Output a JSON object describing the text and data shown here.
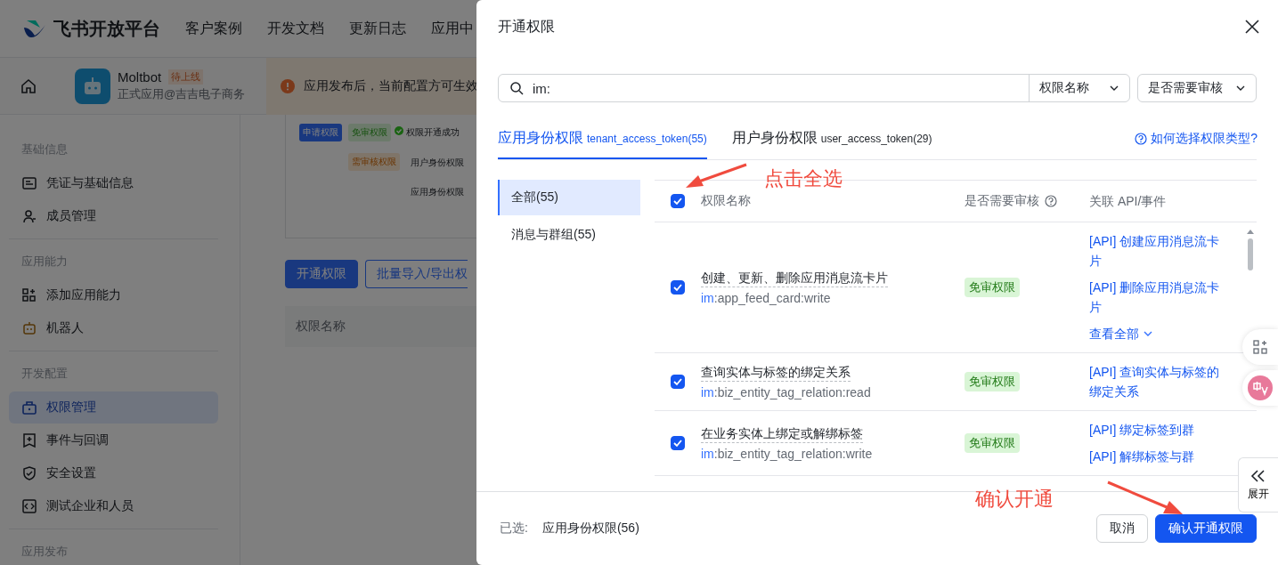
{
  "nav": {
    "brand": "飞书开放平台",
    "links": [
      "客户案例",
      "开发文档",
      "更新日志",
      "应用中"
    ]
  },
  "app": {
    "name": "Moltbot",
    "status": "待上线",
    "subtitle": "正式应用@吉吉电子商务",
    "notice": "应用发布后，当前配置方可生效"
  },
  "sidebar": {
    "sections": [
      {
        "title": "基础信息",
        "items": [
          {
            "label": "凭证与基础信息",
            "selected": false
          },
          {
            "label": "成员管理",
            "selected": false
          }
        ]
      },
      {
        "title": "应用能力",
        "items": [
          {
            "label": "添加应用能力",
            "selected": false
          },
          {
            "label": "机器人",
            "selected": false
          }
        ]
      },
      {
        "title": "开发配置",
        "items": [
          {
            "label": "权限管理",
            "selected": true
          },
          {
            "label": "事件与回调",
            "selected": false
          },
          {
            "label": "安全设置",
            "selected": false
          },
          {
            "label": "测试企业和人员",
            "selected": false
          }
        ]
      },
      {
        "title": "应用发布"
      }
    ]
  },
  "diagram": {
    "apply": "申请权限",
    "free": "免审权限",
    "success": "权限开通成功",
    "review": "需审核权限",
    "user": "用户身份权限",
    "tenant": "应用身份权限"
  },
  "page_buttons": [
    {
      "label": "开通权限",
      "kind": "primary"
    },
    {
      "label": "批量导入/导出权",
      "kind": "outline"
    }
  ],
  "page_table": {
    "columns": [
      "权限名称"
    ]
  },
  "dialog": {
    "title": "开通权限",
    "search": {
      "value": "im:"
    },
    "filters": [
      "权限名称",
      "是否需要审核"
    ],
    "tabs": [
      {
        "label": "应用身份权限",
        "token": "tenant_access_token(55)",
        "selected": true
      },
      {
        "label": "用户身份权限",
        "token": "user_access_token(29)",
        "selected": false
      }
    ],
    "help_link": "如何选择权限类型?",
    "categories": [
      {
        "label": "全部(55)",
        "selected": true
      },
      {
        "label": "消息与群组(55)",
        "selected": false
      }
    ],
    "table": {
      "select_all": {
        "checked": true
      },
      "columns": [
        "权限名称",
        "是否需要审核",
        "关联 API/事件"
      ],
      "rows": [
        {
          "checked": true,
          "name": "创建、更新、删除应用消息流卡片",
          "scope_match": "im",
          "scope": ":app_feed_card:write",
          "review": "免审权限",
          "apis": [
            "[API] 创建应用消息流卡片",
            "[API] 删除应用消息流卡片"
          ],
          "more": "查看全部"
        },
        {
          "checked": true,
          "name": "查询实体与标签的绑定关系",
          "scope_match": "im",
          "scope": ":biz_entity_tag_relation:read",
          "review": "免审权限",
          "apis": [
            "[API] 查询实体与标签的绑定关系"
          ]
        },
        {
          "checked": true,
          "name": "在业务实体上绑定或解绑标签",
          "scope_match": "im",
          "scope": ":biz_entity_tag_relation:write",
          "review": "免审权限",
          "apis": [
            "[API] 绑定标签到群",
            "[API] 解绑标签与群"
          ]
        }
      ]
    },
    "footer": {
      "label": "已选:",
      "selection": "应用身份权限(56)",
      "buttons": [
        {
          "label": "取消",
          "kind": "default"
        },
        {
          "label": "确认开通权限",
          "kind": "primary"
        }
      ]
    }
  },
  "annotations": [
    {
      "text": "点击全选"
    },
    {
      "text": "确认开通"
    }
  ],
  "float": {
    "expand": "展开"
  }
}
